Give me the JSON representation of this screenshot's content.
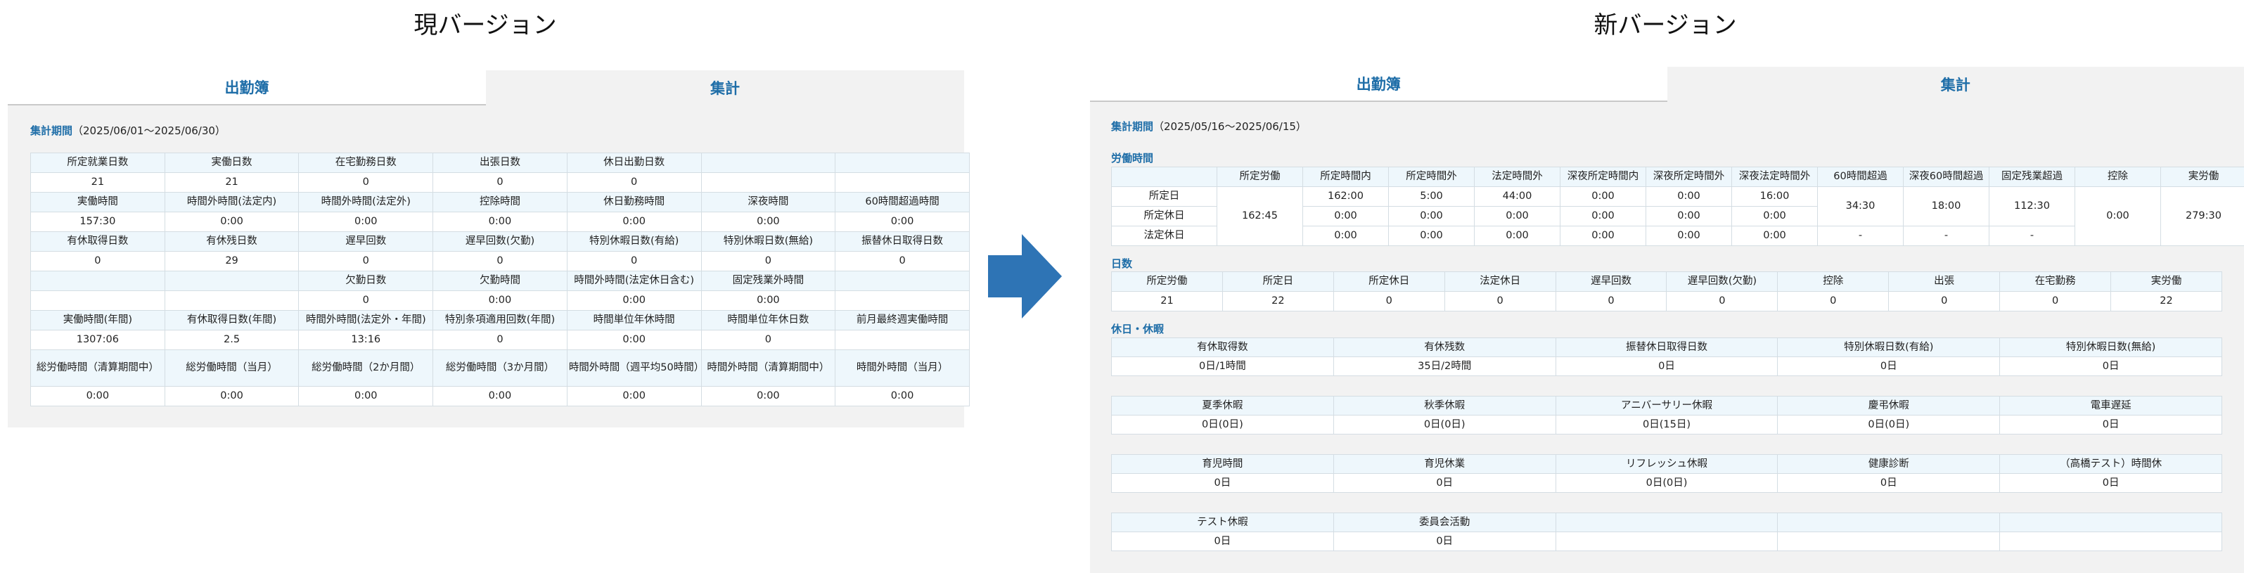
{
  "headings": {
    "current": "現バージョン",
    "new": "新バージョン"
  },
  "tabs": {
    "attendance": "出勤簿",
    "summary": "集計"
  },
  "left": {
    "period_label": "集計期間",
    "period_value": "（2025/06/01～2025/06/30）",
    "rows": [
      {
        "type": "h",
        "cells": [
          "所定就業日数",
          "実働日数",
          "在宅勤務日数",
          "出張日数",
          "休日出勤日数",
          "",
          ""
        ]
      },
      {
        "type": "v",
        "cells": [
          "21",
          "21",
          "0",
          "0",
          "0",
          "",
          ""
        ]
      },
      {
        "type": "h",
        "cells": [
          "実働時間",
          "時間外時間(法定内)",
          "時間外時間(法定外)",
          "控除時間",
          "休日勤務時間",
          "深夜時間",
          "60時間超過時間"
        ]
      },
      {
        "type": "v",
        "cells": [
          "157:30",
          "0:00",
          "0:00",
          "0:00",
          "0:00",
          "0:00",
          "0:00"
        ]
      },
      {
        "type": "h",
        "cells": [
          "有休取得日数",
          "有休残日数",
          "遅早回数",
          "遅早回数(欠勤)",
          "特別休暇日数(有給)",
          "特別休暇日数(無給)",
          "振替休日取得日数"
        ]
      },
      {
        "type": "v",
        "cells": [
          "0",
          "29",
          "0",
          "0",
          "0",
          "0",
          "0"
        ]
      },
      {
        "type": "h",
        "cells": [
          "",
          "",
          "欠勤日数",
          "欠勤時間",
          "時間外時間(法定休日含む)",
          "固定残業外時間",
          ""
        ]
      },
      {
        "type": "v",
        "cells": [
          "",
          "",
          "0",
          "0:00",
          "0:00",
          "0:00",
          ""
        ]
      },
      {
        "type": "h",
        "cells": [
          "実働時間(年間)",
          "有休取得日数(年間)",
          "時間外時間(法定外・年間)",
          "特別条項適用回数(年間)",
          "時間単位年休時間",
          "時間単位年休日数",
          "前月最終週実働時間"
        ]
      },
      {
        "type": "v",
        "cells": [
          "1307:06",
          "2.5",
          "13:16",
          "0",
          "0:00",
          "0",
          ""
        ]
      },
      {
        "type": "h",
        "cells": [
          "総労働時間（清算期間中）",
          "総労働時間（当月）",
          "総労働時間（2か月間）",
          "総労働時間（3か月間）",
          "時間外時間（週平均50時間）",
          "時間外時間（清算期間中）",
          "時間外時間（当月）"
        ]
      },
      {
        "type": "v",
        "cells": [
          "0:00",
          "0:00",
          "0:00",
          "0:00",
          "0:00",
          "0:00",
          "0:00"
        ]
      }
    ]
  },
  "right": {
    "period_label": "集計期間",
    "period_value": "（2025/05/16～2025/06/15）",
    "work_title": "労働時間",
    "work_headers": [
      "",
      "所定労働",
      "所定時間内",
      "所定時間外",
      "法定時間外",
      "深夜所定時間内",
      "深夜所定時間外",
      "深夜法定時間外",
      "60時間超過",
      "深夜60時間超過",
      "固定残業超過",
      "控除",
      "実労働"
    ],
    "work_rows": [
      {
        "label": "所定日",
        "cells": [
          "162:00",
          "5:00",
          "44:00",
          "0:00",
          "0:00",
          "16:00"
        ]
      },
      {
        "label": "所定休日",
        "cells": [
          "0:00",
          "0:00",
          "0:00",
          "0:00",
          "0:00",
          "0:00"
        ]
      },
      {
        "label": "法定休日",
        "cells": [
          "0:00",
          "0:00",
          "0:00",
          "0:00",
          "0:00",
          "0:00"
        ]
      }
    ],
    "work_merged": {
      "scheduled_work": "162:45",
      "over60": "34:30",
      "night_over60": "18:00",
      "fixed_overtime_excess": "112:30",
      "deduction": "0:00",
      "actual_work": "279:30",
      "dash": "-"
    },
    "days_title": "日数",
    "days_headers": [
      "所定労働",
      "所定日",
      "所定休日",
      "法定休日",
      "遅早回数",
      "遅早回数(欠勤)",
      "控除",
      "出張",
      "在宅勤務",
      "実労働"
    ],
    "days_values": [
      "21",
      "22",
      "0",
      "0",
      "0",
      "0",
      "0",
      "0",
      "0",
      "22"
    ],
    "leave_title": "休日・休暇",
    "leave_blocks": [
      {
        "headers": [
          "有休取得数",
          "有休残数",
          "振替休日取得日数",
          "特別休暇日数(有給)",
          "特別休暇日数(無給)"
        ],
        "values": [
          "0日/1時間",
          "35日/2時間",
          "0日",
          "0日",
          "0日"
        ]
      },
      {
        "headers": [
          "夏季休暇",
          "秋季休暇",
          "アニバーサリー休暇",
          "慶弔休暇",
          "電車遅延"
        ],
        "values": [
          "0日(0日)",
          "0日(0日)",
          "0日(15日)",
          "0日(0日)",
          "0日"
        ]
      },
      {
        "headers": [
          "育児時間",
          "育児休業",
          "リフレッシュ休暇",
          "健康診断",
          "（高橋テスト）時間休"
        ],
        "values": [
          "0日",
          "0日",
          "0日(0日)",
          "0日",
          "0日"
        ]
      },
      {
        "headers": [
          "テスト休暇",
          "委員会活動",
          "",
          "",
          ""
        ],
        "values": [
          "0日",
          "0日",
          "",
          "",
          ""
        ]
      }
    ]
  },
  "colors": {
    "accent": "#1f6ea8",
    "arrow": "#2e74b5",
    "header_cell": "#eef7fc",
    "panel": "#f2f2f2"
  },
  "icons": {
    "arrow": "right-arrow-icon"
  }
}
